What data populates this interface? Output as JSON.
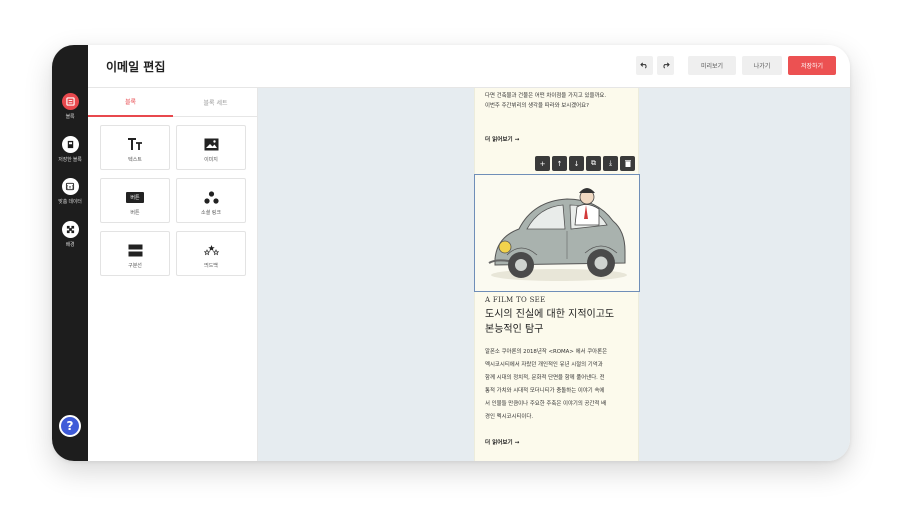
{
  "header": {
    "title": "이메일 편집",
    "undo_icon": "undo-icon",
    "redo_icon": "redo-icon",
    "preview_label": "미리보기",
    "exit_label": "나가기",
    "save_label": "저장하기"
  },
  "nav": {
    "items": [
      {
        "label": "블록",
        "icon": "blocks-icon"
      },
      {
        "label": "저장한 블록",
        "icon": "saved-block-icon"
      },
      {
        "label": "맞춤 데이터",
        "icon": "custom-data-icon"
      },
      {
        "label": "배경",
        "icon": "background-icon"
      }
    ],
    "help_label": "?"
  },
  "panel": {
    "tabs": [
      "블록",
      "블록 세트"
    ],
    "blocks": [
      {
        "label": "텍스트",
        "icon": "text-icon"
      },
      {
        "label": "이미지",
        "icon": "image-icon"
      },
      {
        "label": "버튼",
        "icon": "button-icon",
        "chip": "버튼"
      },
      {
        "label": "소셜 링크",
        "icon": "social-link-icon"
      },
      {
        "label": "구분선",
        "icon": "divider-icon"
      },
      {
        "label": "띄드백",
        "icon": "feedback-icon"
      }
    ]
  },
  "email": {
    "intro_lines": [
      "다면 건축물과 건물은 어떤 차이점을 가지고 있을까요.",
      "이번주 주간뷔리의 생각을 따라와 보시겠어요?"
    ],
    "read_more": "더 읽어보기 →",
    "toolbar": [
      "+",
      "↑",
      "↓",
      "⧉",
      "⤓",
      "🗑"
    ],
    "kicker": "A FILM TO SEE",
    "headline_lines": [
      "도시의 진실에 대한 지적이고도",
      "본능적인 탐구"
    ],
    "body_lines": [
      "알폰소 쿠아론의 2018년작 <ROMA> 에서 쿠아론은",
      "멕시코시티에서 자랐던 개인적인 유년 시절의 기억과",
      "함께 시대의 정치적, 문화적 단면을 함께 풀어낸다. 전",
      "통적 가치와 시대적 모더니티가 충돌하는 이야기 속에",
      "서 인물들 만큼이나 주요한 주축은 이야기의 공간적 배",
      "경인 멕시코시티이다."
    ],
    "read_more_2": "더 읽어보기 →"
  },
  "colors": {
    "accent": "#e8484d",
    "rail": "#1d1d1d",
    "canvas": "#e6ecf0",
    "sheet": "#fcfaec"
  }
}
